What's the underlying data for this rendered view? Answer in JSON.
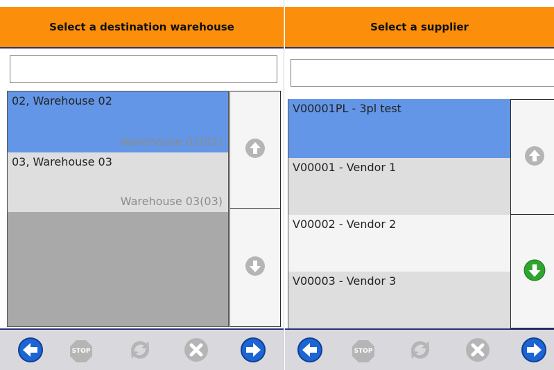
{
  "left_panel": {
    "title": "Select a destination warehouse",
    "search": {
      "value": "",
      "placeholder": ""
    },
    "items": [
      {
        "title": "02, Warehouse 02",
        "subtitle": "Warehouse 02(02)",
        "selected": true
      },
      {
        "title": "03, Warehouse 03",
        "subtitle": "Warehouse 03(03)",
        "selected": false
      }
    ],
    "scroll_up_icon": "up-arrow-circle-disabled",
    "scroll_down_icon": "down-arrow-circle-disabled"
  },
  "right_panel": {
    "title": "Select a supplier",
    "search": {
      "value": "",
      "placeholder": ""
    },
    "items": [
      {
        "title": "V00001PL - 3pl test",
        "selected": true
      },
      {
        "title": "V00001 - Vendor 1",
        "selected": false
      },
      {
        "title": "V00002 - Vendor 2",
        "selected": false
      },
      {
        "title": "V00003 - Vendor 3",
        "selected": false
      }
    ],
    "scroll_up_icon": "up-arrow-circle-disabled",
    "scroll_down_icon": "down-arrow-circle-green"
  },
  "toolbar": {
    "back_icon": "left-arrow-circle",
    "stop_label": "STOP",
    "refresh_icon": "refresh-arrows",
    "cancel_icon": "x-circle",
    "next_icon": "right-arrow-circle"
  },
  "colors": {
    "header_bg": "#fb8f0b",
    "header_border": "#2b2f6e",
    "selected_row": "#6396e6",
    "row_light": "#dedede",
    "row_white": "#f4f4f4",
    "list_empty": "#a9a9a9",
    "toolbar_bg": "#d9d9dd",
    "nav_blue": "#1d64d4",
    "disabled_grey": "#b5b5b5",
    "green_arrow": "#2fa52f"
  }
}
